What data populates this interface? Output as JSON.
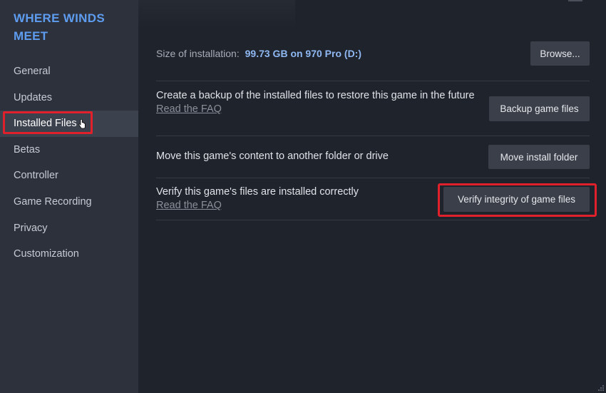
{
  "sidebar": {
    "game_title": "WHERE WINDS MEET",
    "items": [
      {
        "label": "General"
      },
      {
        "label": "Updates"
      },
      {
        "label": "Installed Files"
      },
      {
        "label": "Betas"
      },
      {
        "label": "Controller"
      },
      {
        "label": "Game Recording"
      },
      {
        "label": "Privacy"
      },
      {
        "label": "Customization"
      }
    ],
    "active_item": "Installed Files"
  },
  "main": {
    "install_size_label": "Size of installation:",
    "install_size_value": "99.73 GB on 970 Pro (D:)",
    "browse_button": "Browse...",
    "backup": {
      "text": "Create a backup of the installed files to restore this game in the future",
      "faq": "Read the FAQ",
      "button": "Backup game files"
    },
    "move": {
      "text": "Move this game's content to another folder or drive",
      "button": "Move install folder"
    },
    "verify": {
      "text": "Verify this game's files are installed correctly",
      "faq": "Read the FAQ",
      "button": "Verify integrity of game files"
    }
  },
  "colors": {
    "accent": "#5e9cf0",
    "highlight": "#e0202a",
    "sidebar_bg": "#2c313b",
    "main_bg": "#1f232b"
  }
}
